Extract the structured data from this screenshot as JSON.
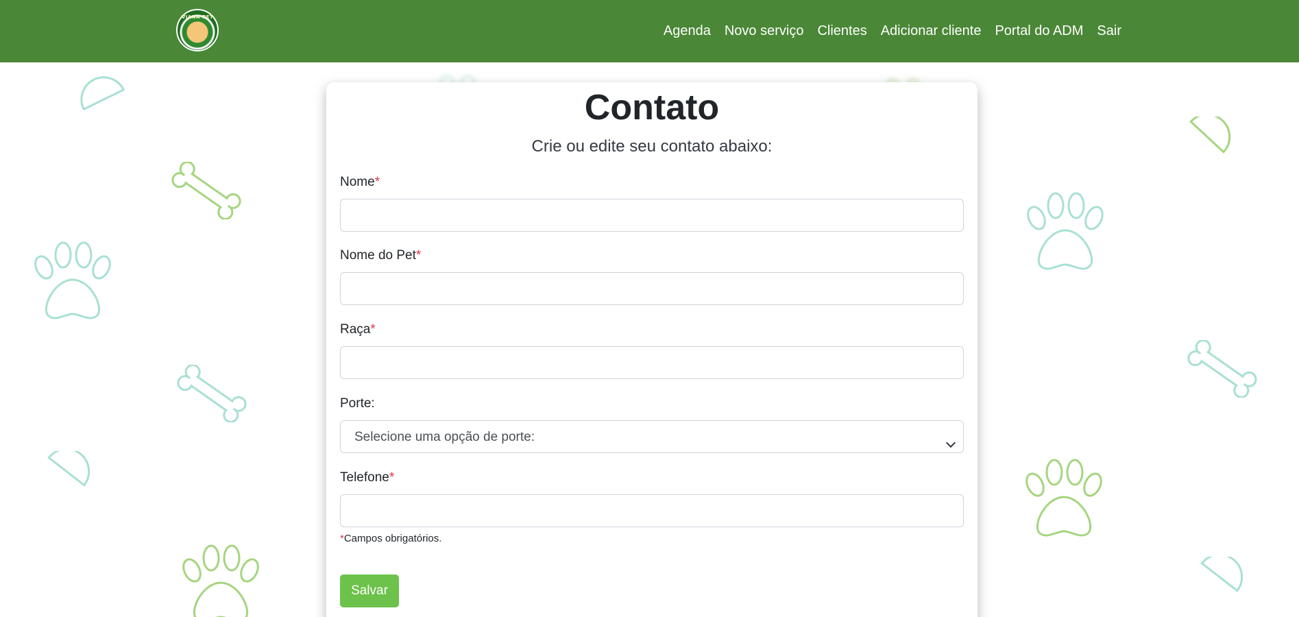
{
  "brand": {
    "logo_text": "VIANA PET"
  },
  "nav": {
    "items": [
      {
        "label": "Agenda"
      },
      {
        "label": "Novo serviço"
      },
      {
        "label": "Clientes"
      },
      {
        "label": "Adicionar cliente"
      },
      {
        "label": "Portal do ADM"
      },
      {
        "label": "Sair"
      }
    ]
  },
  "form": {
    "title": "Contato",
    "subtitle": "Crie ou edite seu contato abaixo:",
    "required_marker": "*",
    "fields": {
      "nome": {
        "label": "Nome",
        "value": ""
      },
      "nome_pet": {
        "label": "Nome do Pet",
        "value": ""
      },
      "raca": {
        "label": "Raça",
        "value": ""
      },
      "porte": {
        "label": "Porte:",
        "selected": "Selecione uma opção de porte:"
      },
      "telefone": {
        "label": "Telefone",
        "value": ""
      }
    },
    "required_note": "Campos obrigatórios.",
    "save_label": "Salvar"
  },
  "colors": {
    "navbar": "#4a8736",
    "button": "#6cc24a",
    "required": "#dc3545",
    "deco_teal": "#a8e0d2",
    "deco_green": "#a5d57f"
  }
}
